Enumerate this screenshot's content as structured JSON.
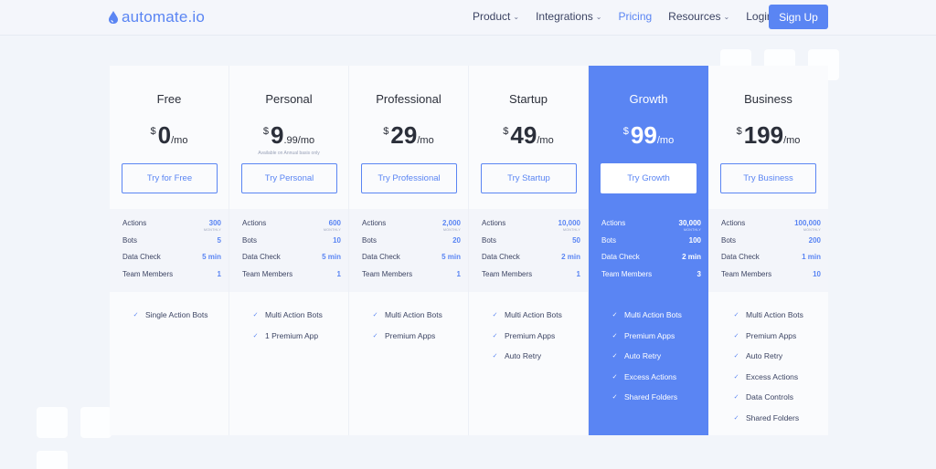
{
  "header": {
    "logo_text": "automate.io",
    "nav": [
      {
        "label": "Product",
        "dropdown": true,
        "active": false
      },
      {
        "label": "Integrations",
        "dropdown": true,
        "active": false
      },
      {
        "label": "Pricing",
        "dropdown": false,
        "active": true
      },
      {
        "label": "Resources",
        "dropdown": true,
        "active": false
      },
      {
        "label": "Login",
        "dropdown": false,
        "active": false
      }
    ],
    "signup_label": "Sign Up"
  },
  "colors": {
    "accent": "#5a85f3",
    "text": "#2b2f3a",
    "background": "#f2f5fa"
  },
  "plans": [
    {
      "name": "Free",
      "currency": "$",
      "amount": "0",
      "decimal": "",
      "period": "/mo",
      "note": "",
      "cta": "Try for Free",
      "highlighted": false,
      "stats": [
        {
          "label": "Actions",
          "value": "300",
          "sub": "MONTHLY"
        },
        {
          "label": "Bots",
          "value": "5",
          "sub": ""
        },
        {
          "label": "Data Check",
          "value": "5 min",
          "sub": ""
        },
        {
          "label": "Team Members",
          "value": "1",
          "sub": ""
        }
      ],
      "features": [
        "Single Action Bots"
      ]
    },
    {
      "name": "Personal",
      "currency": "$",
      "amount": "9",
      "decimal": ".99",
      "period": " /mo",
      "note": "Available on Annual basis only",
      "cta": "Try Personal",
      "highlighted": false,
      "stats": [
        {
          "label": "Actions",
          "value": "600",
          "sub": "MONTHLY"
        },
        {
          "label": "Bots",
          "value": "10",
          "sub": ""
        },
        {
          "label": "Data Check",
          "value": "5 min",
          "sub": ""
        },
        {
          "label": "Team Members",
          "value": "1",
          "sub": ""
        }
      ],
      "features": [
        "Multi Action Bots",
        "1 Premium App"
      ]
    },
    {
      "name": "Professional",
      "currency": "$",
      "amount": "29",
      "decimal": "",
      "period": "/mo",
      "note": "",
      "cta": "Try Professional",
      "highlighted": false,
      "stats": [
        {
          "label": "Actions",
          "value": "2,000",
          "sub": "MONTHLY"
        },
        {
          "label": "Bots",
          "value": "20",
          "sub": ""
        },
        {
          "label": "Data Check",
          "value": "5 min",
          "sub": ""
        },
        {
          "label": "Team Members",
          "value": "1",
          "sub": ""
        }
      ],
      "features": [
        "Multi Action Bots",
        "Premium Apps"
      ]
    },
    {
      "name": "Startup",
      "currency": "$",
      "amount": "49",
      "decimal": "",
      "period": "/mo",
      "note": "",
      "cta": "Try Startup",
      "highlighted": false,
      "stats": [
        {
          "label": "Actions",
          "value": "10,000",
          "sub": "MONTHLY"
        },
        {
          "label": "Bots",
          "value": "50",
          "sub": ""
        },
        {
          "label": "Data Check",
          "value": "2 min",
          "sub": ""
        },
        {
          "label": "Team Members",
          "value": "1",
          "sub": ""
        }
      ],
      "features": [
        "Multi Action Bots",
        "Premium Apps",
        "Auto Retry"
      ]
    },
    {
      "name": "Growth",
      "currency": "$",
      "amount": "99",
      "decimal": "",
      "period": "/mo",
      "note": "",
      "cta": "Try Growth",
      "highlighted": true,
      "stats": [
        {
          "label": "Actions",
          "value": "30,000",
          "sub": "MONTHLY"
        },
        {
          "label": "Bots",
          "value": "100",
          "sub": ""
        },
        {
          "label": "Data Check",
          "value": "2 min",
          "sub": ""
        },
        {
          "label": "Team Members",
          "value": "3",
          "sub": ""
        }
      ],
      "features": [
        "Multi Action Bots",
        "Premium Apps",
        "Auto Retry",
        "Excess Actions",
        "Shared Folders"
      ]
    },
    {
      "name": "Business",
      "currency": "$",
      "amount": "199",
      "decimal": "",
      "period": "/mo",
      "note": "",
      "cta": "Try Business",
      "highlighted": false,
      "stats": [
        {
          "label": "Actions",
          "value": "100,000",
          "sub": "MONTHLY"
        },
        {
          "label": "Bots",
          "value": "200",
          "sub": ""
        },
        {
          "label": "Data Check",
          "value": "1 min",
          "sub": ""
        },
        {
          "label": "Team Members",
          "value": "10",
          "sub": ""
        }
      ],
      "features": [
        "Multi Action Bots",
        "Premium Apps",
        "Auto Retry",
        "Excess Actions",
        "Data Controls",
        "Shared Folders"
      ]
    }
  ]
}
